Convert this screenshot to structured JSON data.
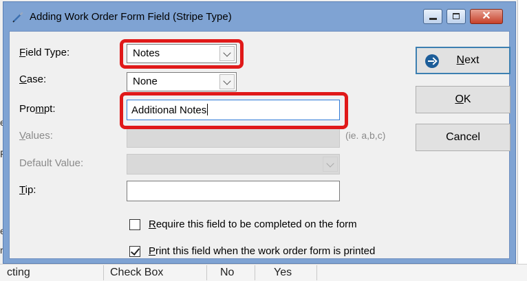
{
  "window": {
    "title": "Adding Work Order Form Field  (Stripe Type)",
    "close_glyph": "✕"
  },
  "form": {
    "field_type": {
      "label_pre": "",
      "label_u": "F",
      "label_post": "ield Type:",
      "value": "Notes"
    },
    "case": {
      "label_pre": "",
      "label_u": "C",
      "label_post": "ase:",
      "value": "None"
    },
    "prompt": {
      "label_pre": "Pro",
      "label_u": "m",
      "label_post": "pt:",
      "value": "Additional Notes"
    },
    "values": {
      "label_pre": "",
      "label_u": "V",
      "label_post": "alues:",
      "value": "",
      "hint": "(ie. a,b,c)"
    },
    "default_value": {
      "label": "Default Value:",
      "value": ""
    },
    "tip": {
      "label_pre": "",
      "label_u": "T",
      "label_post": "ip:",
      "value": ""
    },
    "require_checkbox": {
      "label_pre": "",
      "label_u": "R",
      "label_post": "equire this field to be completed on the form",
      "checked": false
    },
    "print_checkbox": {
      "label_pre": "",
      "label_u": "P",
      "label_post": "rint this field when the work order form is printed",
      "checked": true
    }
  },
  "buttons": {
    "next": {
      "label_pre": "",
      "label_u": "N",
      "label_post": "ext"
    },
    "ok": {
      "label_pre": "",
      "label_u": "O",
      "label_post": "K"
    },
    "cancel": {
      "label": "Cancel"
    }
  },
  "background": {
    "bottom_row": [
      "cting",
      "Check Box",
      "No",
      "Yes"
    ],
    "left_chars": [
      "e",
      "F",
      "e",
      "r"
    ]
  },
  "colors": {
    "highlight": "#e01919",
    "titlebar": "#7fa3d3",
    "dialog_body": "#f0f0f0"
  }
}
